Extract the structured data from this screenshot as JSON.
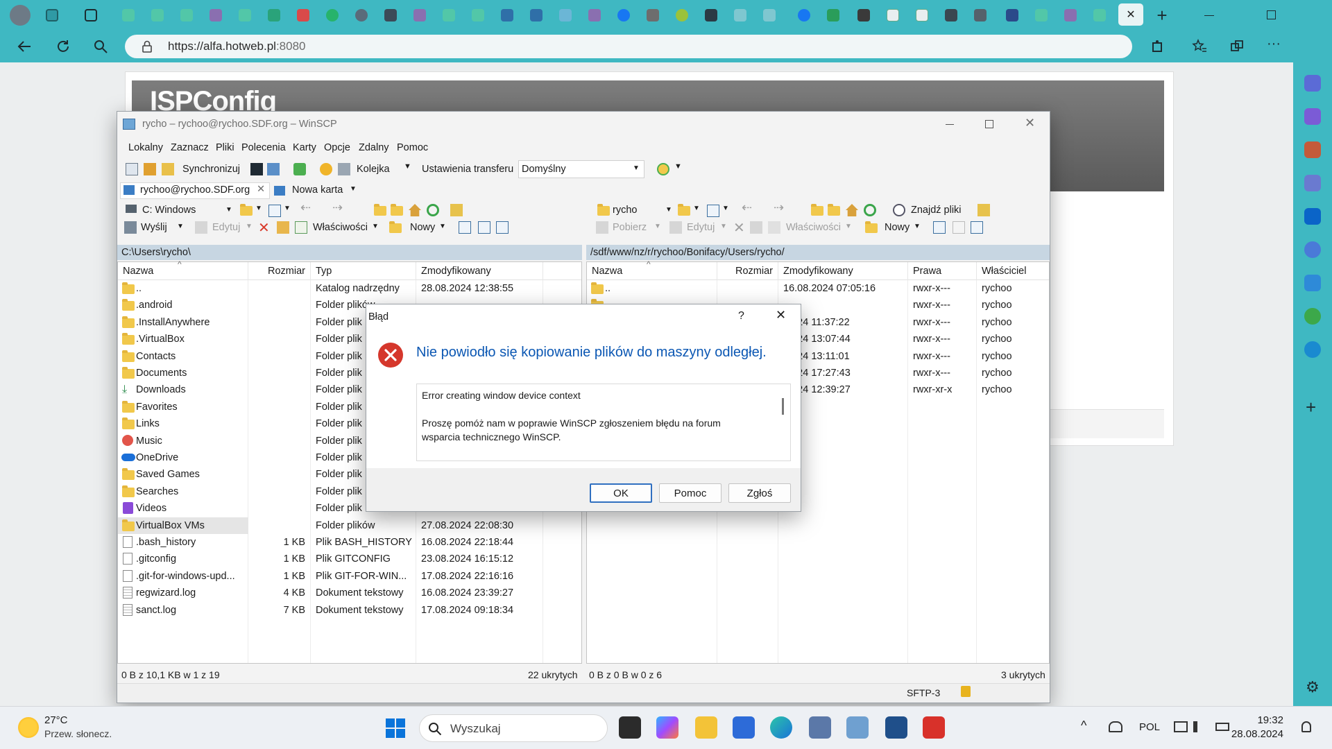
{
  "browser": {
    "url_main": "https://alfa.hotweb.pl",
    "url_port": ":8080",
    "tab_close": "✕",
    "new_tab": "+"
  },
  "page": {
    "isp_title": "ISPConfig"
  },
  "winscp": {
    "title": "rycho – rychoo@rychoo.SDF.org – WinSCP",
    "menu": [
      "Lokalny",
      "Zaznacz",
      "Pliki",
      "Polecenia",
      "Karty",
      "Opcje",
      "Zdalny",
      "Pomoc"
    ],
    "toolbar": {
      "sync_label": "Synchronizuj",
      "queue_label": "Kolejka",
      "transfer_settings_label": "Ustawienia transferu",
      "transfer_preset": "Domyślny"
    },
    "tabs": {
      "session_tab": "rychoo@rychoo.SDF.org",
      "new_tab": "Nowa karta"
    },
    "local": {
      "drive": "C: Windows",
      "send_label": "Wyślij",
      "edit_label": "Edytuj",
      "properties_label": "Właściwości",
      "new_label": "Nowy",
      "path": "C:\\Users\\rycho\\",
      "columns": [
        "Nazwa",
        "Rozmiar",
        "Typ",
        "Zmodyfikowany"
      ],
      "rows": [
        {
          "name": "..",
          "size": "",
          "type": "Katalog nadrzędny",
          "date": "28.08.2024 12:38:55",
          "icon": "parent-folder"
        },
        {
          "name": ".android",
          "size": "",
          "type": "Folder plików",
          "date": "",
          "icon": "folder"
        },
        {
          "name": ".InstallAnywhere",
          "size": "",
          "type": "Folder plik",
          "date": "",
          "icon": "folder"
        },
        {
          "name": ".VirtualBox",
          "size": "",
          "type": "Folder plik",
          "date": "",
          "icon": "folder"
        },
        {
          "name": "Contacts",
          "size": "",
          "type": "Folder plik",
          "date": "",
          "icon": "folder"
        },
        {
          "name": "Documents",
          "size": "",
          "type": "Folder plik",
          "date": "",
          "icon": "folder"
        },
        {
          "name": "Downloads",
          "size": "",
          "type": "Folder plik",
          "date": "",
          "icon": "download"
        },
        {
          "name": "Favorites",
          "size": "",
          "type": "Folder plik",
          "date": "",
          "icon": "folder"
        },
        {
          "name": "Links",
          "size": "",
          "type": "Folder plik",
          "date": "",
          "icon": "folder"
        },
        {
          "name": "Music",
          "size": "",
          "type": "Folder plik",
          "date": "",
          "icon": "music"
        },
        {
          "name": "OneDrive",
          "size": "",
          "type": "Folder plik",
          "date": "",
          "icon": "cloud"
        },
        {
          "name": "Saved Games",
          "size": "",
          "type": "Folder plik",
          "date": "",
          "icon": "folder"
        },
        {
          "name": "Searches",
          "size": "",
          "type": "Folder plik",
          "date": "",
          "icon": "folder"
        },
        {
          "name": "Videos",
          "size": "",
          "type": "Folder plik",
          "date": "",
          "icon": "video"
        },
        {
          "name": "VirtualBox VMs",
          "size": "",
          "type": "Folder plików",
          "date": "27.08.2024 22:08:30",
          "icon": "folder"
        },
        {
          "name": ".bash_history",
          "size": "1 KB",
          "type": "Plik BASH_HISTORY",
          "date": "16.08.2024 22:18:44",
          "icon": "file"
        },
        {
          "name": ".gitconfig",
          "size": "1 KB",
          "type": "Plik GITCONFIG",
          "date": "23.08.2024 16:15:12",
          "icon": "file"
        },
        {
          "name": ".git-for-windows-upd...",
          "size": "1 KB",
          "type": "Plik GIT-FOR-WIN...",
          "date": "17.08.2024 22:16:16",
          "icon": "file"
        },
        {
          "name": "regwizard.log",
          "size": "4 KB",
          "type": "Dokument tekstowy",
          "date": "16.08.2024 23:39:27",
          "icon": "text"
        },
        {
          "name": "sanct.log",
          "size": "7 KB",
          "type": "Dokument tekstowy",
          "date": "17.08.2024 09:18:34",
          "icon": "text"
        }
      ],
      "status_left": "0 B z 10,1 KB w 1 z 19",
      "status_hidden": "22 ukrytych"
    },
    "remote": {
      "folder": "rycho",
      "find_files_label": "Znajdź pliki",
      "download_label": "Pobierz",
      "edit_label": "Edytuj",
      "properties_label": "Właściwości",
      "new_label": "Nowy",
      "path": "/sdf/www/nz/r/rychoo/Bonifacy/Users/rycho/",
      "columns": [
        "Nazwa",
        "Rozmiar",
        "Zmodyfikowany",
        "Prawa",
        "Właściciel"
      ],
      "rows": [
        {
          "name": "..",
          "date": "16.08.2024 07:05:16",
          "rights": "rwxr-x---",
          "owner": "rychoo"
        },
        {
          "name": "",
          "date": "",
          "rights": "rwxr-x---",
          "owner": "rychoo"
        },
        {
          "name": "",
          "date": ".2024 11:37:22",
          "rights": "rwxr-x---",
          "owner": "rychoo"
        },
        {
          "name": "",
          "date": ".2024 13:07:44",
          "rights": "rwxr-x---",
          "owner": "rychoo"
        },
        {
          "name": "",
          "date": ".2024 13:11:01",
          "rights": "rwxr-x---",
          "owner": "rychoo"
        },
        {
          "name": "",
          "date": ".2024 17:27:43",
          "rights": "rwxr-x---",
          "owner": "rychoo"
        },
        {
          "name": "",
          "date": ".2024 12:39:27",
          "rights": "rwxr-xr-x",
          "owner": "rychoo"
        }
      ],
      "status_left": "0 B z 0 B w 0 z 6",
      "status_hidden": "3 ukrytych"
    },
    "statusbar": {
      "protocol": "SFTP-3"
    }
  },
  "dialog": {
    "title": "Błąd",
    "help_mark": "?",
    "heading": "Nie powiodło się kopiowanie plików do maszyny odległej.",
    "message_line1": "Error creating window device context",
    "message_line2": "Proszę pomóż nam w poprawie WinSCP zgłoszeniem błędu na forum",
    "message_line3": "wsparcia technicznego WinSCP.",
    "buttons": {
      "ok": "OK",
      "help": "Pomoc",
      "report": "Zgłoś"
    }
  },
  "taskbar": {
    "weather_temp": "27°C",
    "weather_desc": "Przew. słonecz.",
    "search_placeholder": "Wyszukaj",
    "lang": "POL",
    "time": "19:32",
    "date": "28.08.2024"
  },
  "colors": {
    "browser_accent": "#3fb8c2",
    "error_red": "#d5372c",
    "heading_blue": "#0b57b3",
    "selection_gray": "#e5e5e5"
  }
}
